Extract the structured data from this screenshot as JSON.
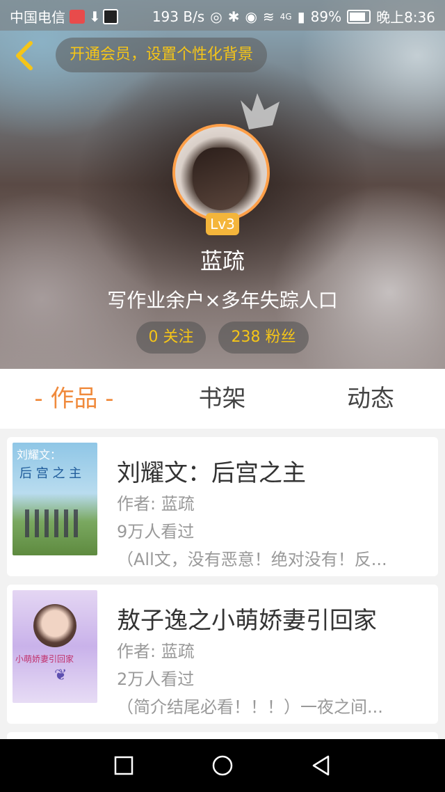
{
  "status_bar": {
    "carrier": "中国电信",
    "speed": "193 B/s",
    "network": "4G",
    "battery": "89%",
    "time": "晚上8:36"
  },
  "header": {
    "vip_banner": "开通会员，设置个性化背景",
    "level": "Lv3",
    "username": "蓝疏",
    "bio": "写作业余户×多年失踪人口",
    "following": "0 关注",
    "fans": "238 粉丝"
  },
  "tabs": [
    {
      "label": "- 作品 -",
      "active": true
    },
    {
      "label": "书架",
      "active": false
    },
    {
      "label": "动态",
      "active": false
    }
  ],
  "works": [
    {
      "title": "刘耀文：后宫之主",
      "author": "作者: 蓝疏",
      "views": "9万人看过",
      "desc": "（All文，没有恶意！绝对没有！反...",
      "cover_title": "刘耀文：",
      "cover_sub": "后 宫 之 主"
    },
    {
      "title": "敖子逸之小萌娇妻引回家",
      "author": "作者: 蓝疏",
      "views": "2万人看过",
      "desc": "（简介结尾必看！！！）一夜之间...",
      "cover_title": "小萌娇妻引回家"
    }
  ],
  "colors": {
    "accent": "#f08a3c",
    "gold": "#f5c518",
    "level_badge": "#f4b53b",
    "avatar_ring": "#ff9f48"
  },
  "icons": {
    "back": "chevron-left-icon",
    "crown": "crown-icon",
    "nav": [
      "square-icon",
      "circle-icon",
      "triangle-back-icon"
    ]
  }
}
